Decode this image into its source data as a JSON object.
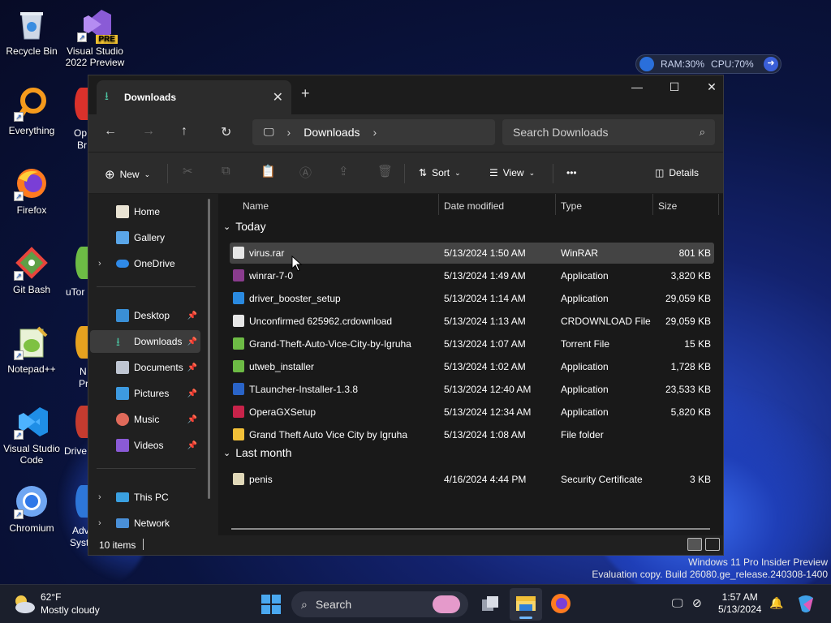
{
  "desktop": {
    "icons": [
      {
        "label": "Recycle Bin"
      },
      {
        "label": "Visual Studio 2022 Preview",
        "badge": "PRE"
      },
      {
        "label": "Everything"
      },
      {
        "label": "Firefox"
      },
      {
        "label": "Git Bash"
      },
      {
        "label": "Notepad++"
      },
      {
        "label": "Visual Studio Code"
      },
      {
        "label": "Chromium"
      }
    ],
    "partial_labels": [
      "Op",
      "Br",
      "uTor",
      "N",
      "Pr",
      "Drive",
      "Adv",
      "Syst"
    ]
  },
  "sysmon": {
    "ram": "RAM:30%",
    "cpu": "CPU:70%"
  },
  "window": {
    "tab_title": "Downloads",
    "new_tab": "+",
    "controls": {
      "minimize": "—",
      "maximize": "☐",
      "close": "✕"
    },
    "breadcrumb": [
      "Downloads"
    ],
    "search_placeholder": "Search Downloads",
    "commands": {
      "new": "New",
      "sort": "Sort",
      "view": "View",
      "more": "•••",
      "details": "Details"
    },
    "sidebar": {
      "top": [
        {
          "label": "Home",
          "icon": "home-icon"
        },
        {
          "label": "Gallery",
          "icon": "gallery-icon"
        },
        {
          "label": "OneDrive",
          "icon": "onedrive-icon"
        }
      ],
      "pinned": [
        {
          "label": "Desktop",
          "icon": "desktop-icon"
        },
        {
          "label": "Downloads",
          "icon": "downloads-icon"
        },
        {
          "label": "Documents",
          "icon": "documents-icon"
        },
        {
          "label": "Pictures",
          "icon": "pictures-icon"
        },
        {
          "label": "Music",
          "icon": "music-icon"
        },
        {
          "label": "Videos",
          "icon": "videos-icon"
        }
      ],
      "bottom": [
        {
          "label": "This PC",
          "icon": "this-pc-icon"
        },
        {
          "label": "Network",
          "icon": "network-icon"
        }
      ]
    },
    "columns": {
      "name": "Name",
      "date": "Date modified",
      "type": "Type",
      "size": "Size"
    },
    "groups": {
      "today": {
        "label": "Today",
        "rows": [
          {
            "name": "virus.rar",
            "date": "5/13/2024 1:50 AM",
            "type": "WinRAR",
            "size": "801 KB",
            "icon": "file-icon",
            "selected": true
          },
          {
            "name": "winrar-7-0",
            "date": "5/13/2024 1:49 AM",
            "type": "Application",
            "size": "3,820 KB",
            "icon": "winrar-icon"
          },
          {
            "name": "driver_booster_setup",
            "date": "5/13/2024 1:14 AM",
            "type": "Application",
            "size": "29,059 KB",
            "icon": "driver-booster-icon"
          },
          {
            "name": "Unconfirmed 625962.crdownload",
            "date": "5/13/2024 1:13 AM",
            "type": "CRDOWNLOAD File",
            "size": "29,059 KB",
            "icon": "file-icon"
          },
          {
            "name": "Grand-Theft-Auto-Vice-City-by-Igruha",
            "date": "5/13/2024 1:07 AM",
            "type": "Torrent File",
            "size": "15 KB",
            "icon": "utorrent-icon"
          },
          {
            "name": "utweb_installer",
            "date": "5/13/2024 1:02 AM",
            "type": "Application",
            "size": "1,728 KB",
            "icon": "utorrent-icon"
          },
          {
            "name": "TLauncher-Installer-1.3.8",
            "date": "5/13/2024 12:40 AM",
            "type": "Application",
            "size": "23,533 KB",
            "icon": "tlauncher-icon"
          },
          {
            "name": "OperaGXSetup",
            "date": "5/13/2024 12:34 AM",
            "type": "Application",
            "size": "5,820 KB",
            "icon": "opera-gx-icon"
          },
          {
            "name": "Grand Theft Auto Vice City by Igruha",
            "date": "5/13/2024 1:08 AM",
            "type": "File folder",
            "size": "",
            "icon": "folder-icon"
          }
        ]
      },
      "last_month": {
        "label": "Last month",
        "rows": [
          {
            "name": "penis",
            "date": "4/16/2024 4:44 PM",
            "type": "Security Certificate",
            "size": "3 KB",
            "icon": "certificate-icon"
          }
        ]
      }
    },
    "status": {
      "count": "10 items"
    }
  },
  "watermark": {
    "line1": "Windows 11 Pro Insider Preview",
    "line2": "Evaluation copy. Build 26080.ge_release.240308-1400"
  },
  "taskbar": {
    "weather_temp": "62°F",
    "weather_desc": "Mostly cloudy",
    "search": "Search",
    "time": "1:57 AM",
    "date": "5/13/2024"
  },
  "colors": {
    "accent": "#4cc2a0",
    "window_bg": "#202020",
    "selected_row": "#444444"
  }
}
